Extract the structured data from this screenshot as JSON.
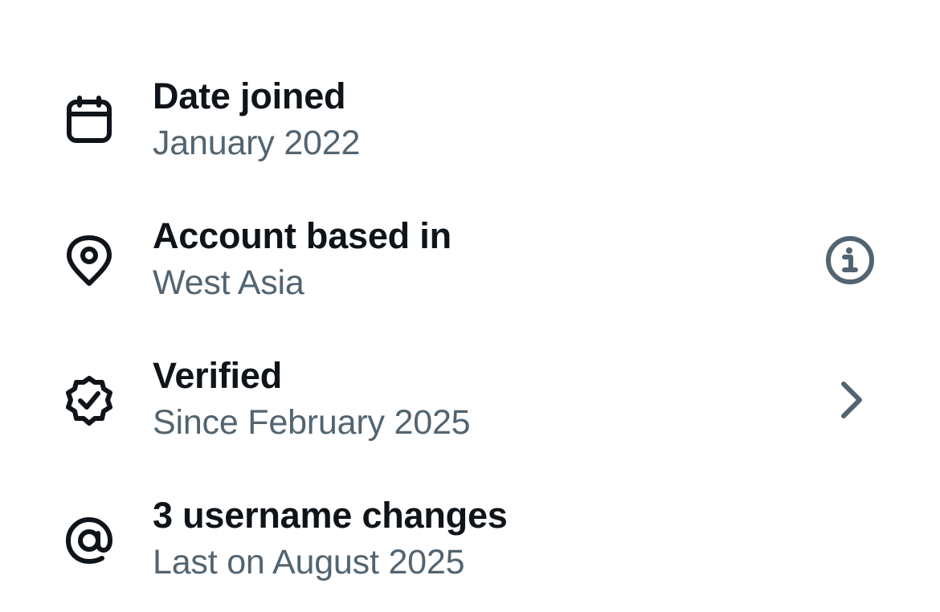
{
  "items": [
    {
      "title": "Date joined",
      "subtitle": "January 2022",
      "icon": "calendar-icon"
    },
    {
      "title": "Account based in",
      "subtitle": "West Asia",
      "icon": "location-pin-icon",
      "trailing_icon": "info-icon"
    },
    {
      "title": "Verified",
      "subtitle": "Since February 2025",
      "icon": "verified-badge-icon",
      "trailing_icon": "chevron-right-icon"
    },
    {
      "title": "3 username changes",
      "subtitle": "Last on August 2025",
      "icon": "at-sign-icon"
    }
  ],
  "colors": {
    "text_primary": "#0f1419",
    "text_secondary": "#536471",
    "icon": "#0f1419",
    "trailing_icon": "#536471",
    "background": "#ffffff"
  }
}
